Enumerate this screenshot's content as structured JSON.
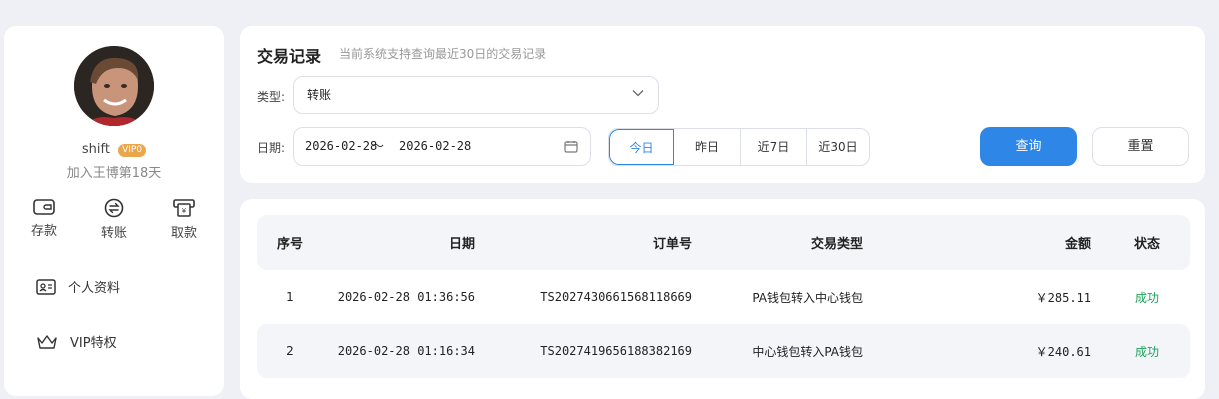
{
  "sidebar": {
    "username": "shift",
    "vip_label": "VIP0",
    "join_text": "加入王博第18天",
    "quick_actions": [
      {
        "label": "存款",
        "icon": "wallet-icon"
      },
      {
        "label": "转账",
        "icon": "transfer-icon"
      },
      {
        "label": "取款",
        "icon": "withdraw-icon"
      }
    ],
    "menu": [
      {
        "label": "个人资料",
        "icon": "profile-card-icon"
      },
      {
        "label": "VIP特权",
        "icon": "crown-icon"
      }
    ]
  },
  "filters": {
    "title": "交易记录",
    "subtitle": "当前系统支持查询最近30日的交易记录",
    "type_label": "类型:",
    "type_value": "转账",
    "date_label": "日期:",
    "date_start": "2026-02-28",
    "date_separator": "～",
    "date_end": "2026-02-28",
    "quick_ranges": [
      "今日",
      "昨日",
      "近7日",
      "近30日"
    ],
    "active_range": "今日",
    "query_label": "查询",
    "reset_label": "重置"
  },
  "table": {
    "columns": [
      "序号",
      "日期",
      "订单号",
      "交易类型",
      "金额",
      "状态"
    ],
    "rows": [
      {
        "no": "1",
        "date": "2026-02-28 01:36:56",
        "order": "TS2027430661568118669",
        "type": "PA钱包转入中心钱包",
        "amount": "￥285.11",
        "status": "成功"
      },
      {
        "no": "2",
        "date": "2026-02-28 01:16:34",
        "order": "TS2027419656188382169",
        "type": "中心钱包转入PA钱包",
        "amount": "￥240.61",
        "status": "成功"
      }
    ]
  },
  "colors": {
    "accent": "#2e86e6",
    "success": "#1ea35a",
    "page_bg": "#eef0f6"
  }
}
